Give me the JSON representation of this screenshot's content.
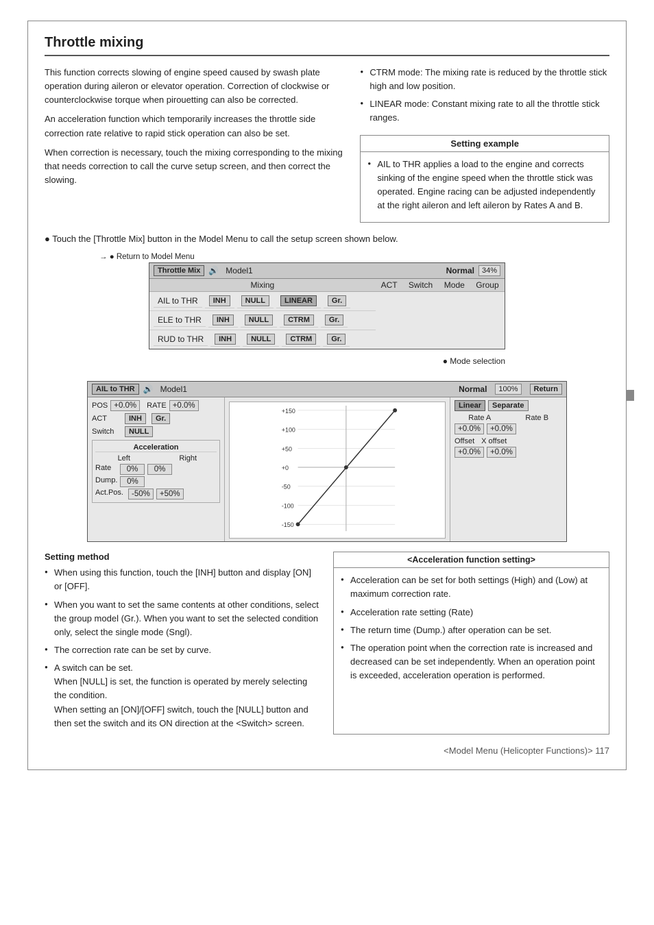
{
  "page": {
    "title": "Throttle mixing",
    "side_tab": "",
    "footer": "<Model Menu (Helicopter Functions)>  117"
  },
  "intro_paragraphs": [
    "This function corrects slowing of engine speed caused by swash plate operation during aileron or elevator operation. Correction of clockwise or counterclockwise torque when pirouetting can also be corrected.",
    "An acceleration function which temporarily increases the throttle side correction rate relative to rapid stick operation can also be set.",
    "When correction is necessary, touch the mixing corresponding to the mixing that needs correction to call the curve setup screen, and then correct the slowing."
  ],
  "bullet_points": [
    "CTRM mode: The mixing rate is reduced by the throttle stick high and low position.",
    "LINEAR mode: Constant mixing rate to all the throttle stick ranges."
  ],
  "setting_example": {
    "title": "Setting example",
    "content": "AIL to THR applies a load to the engine and corrects sinking of the engine speed when the throttle stick was operated. Engine racing can be adjusted independently at the right aileron and left aileron by Rates A and B."
  },
  "touch_instruction": "● Touch the [Throttle Mix] button in the Model Menu to call the setup screen shown below.",
  "return_label": "● Return to Model Menu",
  "screen1": {
    "label": "Throttle Mix",
    "icon": "🔊",
    "model": "Model1",
    "status": "Normal",
    "percent": "34%",
    "col_headers": [
      "Mixing",
      "ACT",
      "Switch",
      "Mode",
      "Group"
    ],
    "rows": [
      {
        "mixing": "AIL to THR",
        "act": "INH",
        "switch": "NULL",
        "mode": "LINEAR",
        "group": "Gr."
      },
      {
        "mixing": "ELE to THR",
        "act": "INH",
        "switch": "NULL",
        "mode": "CTRM",
        "group": "Gr."
      },
      {
        "mixing": "RUD to THR",
        "act": "INH",
        "switch": "NULL",
        "mode": "CTRM",
        "group": "Gr."
      }
    ]
  },
  "mode_selection_note": "● Mode selection",
  "screen2": {
    "label": "AIL to THR",
    "icon": "🔊",
    "model": "Model1",
    "status": "Normal",
    "percent": "100%",
    "return_btn": "Return",
    "pos_label": "POS",
    "pos_val": "+0.0%",
    "rate_label": "RATE",
    "rate_val": "+0.0%",
    "act_label": "ACT",
    "act_val": "INH",
    "switch_label": "Switch",
    "switch_val": "NULL",
    "accel_label": "Acceleration",
    "left_label": "Left",
    "right_label": "Right",
    "rate_row_label": "Rate",
    "rate_left": "0%",
    "rate_right": "0%",
    "dump_label": "Dump.",
    "dump_val": "0%",
    "actpos_label": "Act.Pos.",
    "actpos_left": "-50%",
    "actpos_right": "+50%",
    "chart_labels": [
      "+150",
      "+100",
      "+50",
      "+0",
      "-50",
      "-100",
      "-150"
    ],
    "linear_label": "Linear",
    "separate_label": "Separate",
    "rate_a_label": "Rate A",
    "rate_b_label": "Rate B",
    "rate_a_val": "+0.0%",
    "rate_b_val": "+0.0%",
    "offset_label": "Offset",
    "xoffset_label": "X offset",
    "offset_val": "+0.0%",
    "xoffset_val": "+0.0%"
  },
  "setting_method": {
    "title": "Setting method",
    "bullets": [
      "When using this function, touch the [INH] button and display [ON] or [OFF].",
      "When you want to set the same contents at other conditions, select the group model (Gr.). When you want to set the selected condition only, select the single mode (Sngl).",
      "The correction rate can be set by curve.",
      "A switch can be set.\nWhen [NULL] is set, the function is operated by merely selecting the condition.\nWhen setting an [ON]/[OFF] switch, touch the [NULL] button and then set the switch and its ON direction at the <Switch> screen."
    ]
  },
  "acceleration_function": {
    "title": "<Acceleration function setting>",
    "bullets": [
      "Acceleration can be set for both settings (High) and (Low) at maximum correction rate.",
      "Acceleration rate setting (Rate)",
      "The return time (Dump.) after operation can be set.",
      "The operation point when the correction rate is increased and decreased can be set independently. When an operation point is exceeded, acceleration operation is performed."
    ]
  },
  "footer_text": "<Model Menu (Helicopter Functions)>  117"
}
